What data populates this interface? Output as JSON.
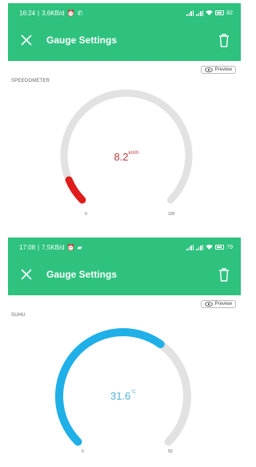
{
  "screens": [
    {
      "status": {
        "time": "16:24",
        "speed": "3,6KB/d",
        "battery": "82"
      },
      "title": "Gauge Settings",
      "preview_label": "Preview",
      "gauge": {
        "name": "SPEEDOMETER",
        "value": "8.2",
        "unit": "km/h",
        "min": "0",
        "max": "100",
        "fill_fraction": 0.082,
        "color": "#e01b1b",
        "value_color": "#b83a3a"
      }
    },
    {
      "status": {
        "time": "17:08",
        "speed": "7,5KB/d",
        "battery": "79"
      },
      "title": "Gauge Settings",
      "preview_label": "Preview",
      "gauge": {
        "name": "SUHU",
        "value": "31.6",
        "unit": "°C",
        "min": "0",
        "max": "50",
        "fill_fraction": 0.632,
        "color": "#1fb0e8",
        "value_color": "#4fb3d9"
      }
    }
  ],
  "icons": {
    "close": "close-icon",
    "delete": "trash-icon",
    "preview": "eye-icon",
    "alarm": "alarm-icon",
    "whatsapp": "whatsapp-icon",
    "wifi": "wifi-icon",
    "battery": "battery-icon"
  },
  "colors": {
    "appbar": "#2ec27e",
    "track": "#e2e2e2"
  }
}
